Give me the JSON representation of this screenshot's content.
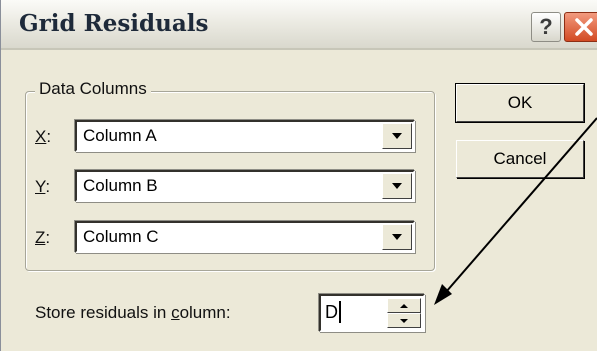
{
  "window": {
    "title": "Grid Residuals",
    "help_label": "?",
    "close_icon": "close-icon",
    "close_color": "#d24a23"
  },
  "data_columns": {
    "legend": "Data Columns",
    "x": {
      "mnemonic": "X",
      "suffix": ":",
      "value": "Column A"
    },
    "y": {
      "mnemonic": "Y",
      "suffix": ":",
      "value": "Column B"
    },
    "z": {
      "mnemonic": "Z",
      "suffix": ":",
      "value": "Column C"
    }
  },
  "buttons": {
    "ok": "OK",
    "cancel": "Cancel"
  },
  "store": {
    "label_before": "Store residuals in ",
    "label_mnemonic": "c",
    "label_after": "olumn:",
    "value": "D"
  },
  "annotation": {
    "icon": "arrow-annotation",
    "color": "#000000"
  }
}
